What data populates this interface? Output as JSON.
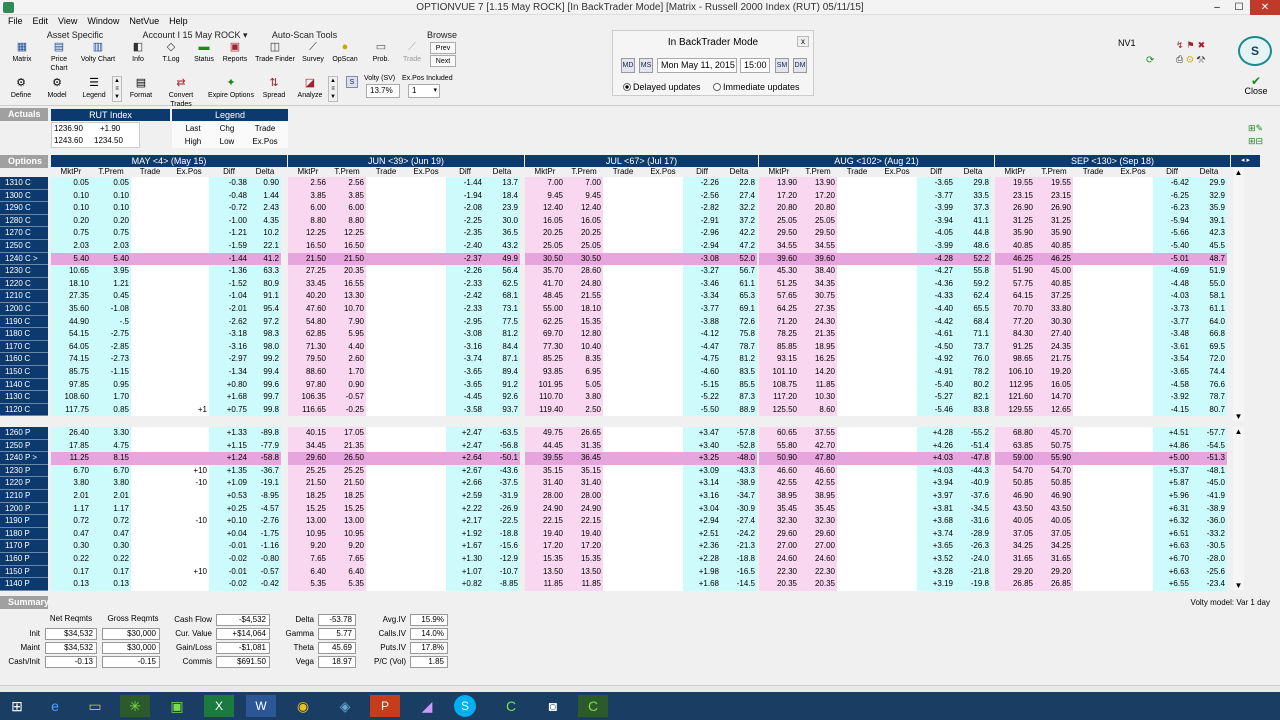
{
  "window": {
    "title": "OPTIONVUE 7    [1.15 May ROCK]    [In BackTrader Mode]    [Matrix - Russell 2000 Index (RUT)  05/11/15]",
    "min": "–",
    "max": "☐",
    "close": "✕"
  },
  "menu": [
    "File",
    "Edit",
    "View",
    "Window",
    "NetVue",
    "Help"
  ],
  "ribbon": {
    "groups": {
      "asset": "Asset Specific",
      "account": "Account I 15 May ROCK ▾",
      "autoscan": "Auto-Scan Tools",
      "browse": "Browse"
    },
    "row1": [
      "Matrix",
      "Price Chart",
      "Volty Chart",
      "Info",
      "T.Log",
      "Status",
      "Reports",
      "Trade Finder",
      "Survey",
      "OpScan",
      "Prob.",
      "Trade"
    ],
    "browse_prev": "Prev",
    "browse_next": "Next",
    "row2": [
      "Define",
      "Model",
      "Legend",
      "Format",
      "Convert Trades",
      "Expire Options",
      "Spread",
      "Analyze"
    ],
    "volty_label": "Volty (SV)",
    "volty_value": "13.7%",
    "expos_label": "Ex.Pos Included",
    "expos_value": "1",
    "s_btn": "S"
  },
  "backtrader": {
    "title": "In BackTrader Mode",
    "date": "Mon May 11, 2015",
    "time": "15:00",
    "delayed": "Delayed updates",
    "immediate": "Immediate updates",
    "btn_md": "MD",
    "btn_ms": "MS",
    "btn_sm": "SM",
    "btn_dm": "DM",
    "close": "x"
  },
  "right_top": {
    "nv": "NV1",
    "close_label": "Close",
    "s_icon": "S"
  },
  "actuals": {
    "label": "Actuals",
    "index_label": "RUT Index",
    "r1a": "1236.90",
    "r1b": "+1.90",
    "r2a": "1243.60",
    "r2b": "1234.50",
    "legend": "Legend",
    "leg": [
      "Last",
      "Chg",
      "Trade",
      "High",
      "Low",
      "Ex.Pos"
    ]
  },
  "options_label": "Options",
  "months": [
    "MAY <4> (May 15)",
    "JUN <39> (Jun 19)",
    "JUL <67> (Jul 17)",
    "AUG <102> (Aug 21)",
    "SEP <130> (Sep 18)"
  ],
  "may_cols": [
    "MktPr",
    "T.Prem",
    "Trade",
    "Ex.Pos",
    "Diff",
    "Delta"
  ],
  "other_cols": [
    "MktPr",
    "T.Prem",
    "Trade",
    "Ex.Pos",
    "Diff",
    "Delta"
  ],
  "calls": [
    [
      "1310 C",
      "0.05",
      "0.05",
      "",
      "",
      "-0.38",
      "0.90",
      "2.56",
      "2.56",
      "-1.44",
      "13.7",
      "7.00",
      "7.00",
      "-2.26",
      "22.8",
      "13.90",
      "13.90",
      "-3.65",
      "29.8",
      "19.55",
      "19.55",
      "-6.42",
      "29.9"
    ],
    [
      "1300 C",
      "0.10",
      "0.10",
      "",
      "",
      "-0.48",
      "1.44",
      "3.85",
      "3.85",
      "-1.94",
      "18.4",
      "9.45",
      "9.45",
      "-2.56",
      "27.4",
      "17.20",
      "17.20",
      "-3.77",
      "33.5",
      "23.15",
      "23.15",
      "-6.25",
      "32.9"
    ],
    [
      "1290 C",
      "0.10",
      "0.10",
      "",
      "",
      "-0.72",
      "2.43",
      "6.00",
      "6.00",
      "-2.08",
      "23.9",
      "12.40",
      "12.40",
      "-2.82",
      "32.2",
      "20.80",
      "20.80",
      "-3.99",
      "37.3",
      "26.90",
      "26.90",
      "-6.23",
      "35.9"
    ],
    [
      "1280 C",
      "0.20",
      "0.20",
      "",
      "",
      "-1.00",
      "4.35",
      "8.80",
      "8.80",
      "-2.25",
      "30.0",
      "16.05",
      "16.05",
      "-2.91",
      "37.2",
      "25.05",
      "25.05",
      "-3.94",
      "41.1",
      "31.25",
      "31.25",
      "-5.94",
      "39.1"
    ],
    [
      "1270 C",
      "0.75",
      "0.75",
      "",
      "",
      "-1.21",
      "10.2",
      "12.25",
      "12.25",
      "-2.35",
      "36.5",
      "20.25",
      "20.25",
      "-2.96",
      "42.2",
      "29.50",
      "29.50",
      "-4.05",
      "44.8",
      "35.90",
      "35.90",
      "-5.66",
      "42.3"
    ],
    [
      "1250 C",
      "2.03",
      "2.03",
      "",
      "",
      "-1.59",
      "22.1",
      "16.50",
      "16.50",
      "-2.40",
      "43.2",
      "25.05",
      "25.05",
      "-2.94",
      "47.2",
      "34.55",
      "34.55",
      "-3.99",
      "48.6",
      "40.85",
      "40.85",
      "-5.40",
      "45.5"
    ],
    [
      "1240 C >",
      "5.40",
      "5.40",
      "",
      "",
      "-1.44",
      "41.2",
      "21.50",
      "21.50",
      "-2.37",
      "49.9",
      "30.50",
      "30.50",
      "-3.08",
      "52.0",
      "39.60",
      "39.60",
      "-4.28",
      "52.2",
      "46.25",
      "46.25",
      "-5.01",
      "48.7"
    ],
    [
      "1230 C",
      "10.65",
      "3.95",
      "",
      "",
      "-1.36",
      "63.3",
      "27.25",
      "20.35",
      "-2.26",
      "56.4",
      "35.70",
      "28.60",
      "-3.27",
      "56.7",
      "45.30",
      "38.40",
      "-4.27",
      "55.8",
      "51.90",
      "45.00",
      "-4.69",
      "51.9"
    ],
    [
      "1220 C",
      "18.10",
      "1.21",
      "",
      "",
      "-1.52",
      "80.9",
      "33.45",
      "16.55",
      "-2.33",
      "62.5",
      "41.70",
      "24.80",
      "-3.46",
      "61.1",
      "51.25",
      "34.35",
      "-4.36",
      "59.2",
      "57.75",
      "40.85",
      "-4.48",
      "55.0"
    ],
    [
      "1210 C",
      "27.35",
      "0.45",
      "",
      "",
      "-1.04",
      "91.1",
      "40.20",
      "13.30",
      "-2.42",
      "68.1",
      "48.45",
      "21.55",
      "-3.34",
      "65.3",
      "57.65",
      "30.75",
      "-4.33",
      "62.4",
      "64.15",
      "37.25",
      "-4.03",
      "58.1"
    ],
    [
      "1200 C",
      "35.60",
      "-1.08",
      "",
      "",
      "-2.01",
      "95.4",
      "47.60",
      "10.70",
      "-2.33",
      "73.1",
      "55.00",
      "18.10",
      "-3.77",
      "69.1",
      "64.25",
      "27.35",
      "-4.40",
      "65.5",
      "70.70",
      "33.80",
      "-3.73",
      "61.1"
    ],
    [
      "1190 C",
      "44.90",
      "-.5",
      "",
      "",
      "-2.62",
      "97.2",
      "54.80",
      "7.90",
      "-2.95",
      "77.5",
      "62.25",
      "15.35",
      "-3.88",
      "72.6",
      "71.20",
      "24.30",
      "-4.42",
      "68.4",
      "77.20",
      "30.30",
      "-3.77",
      "64.0"
    ],
    [
      "1180 C",
      "54.15",
      "-2.75",
      "",
      "",
      "-3.18",
      "98.3",
      "62.85",
      "5.95",
      "-3.08",
      "81.2",
      "69.70",
      "12.80",
      "-4.12",
      "75.8",
      "78.25",
      "21.35",
      "-4.61",
      "71.1",
      "84.30",
      "27.40",
      "-3.48",
      "66.8"
    ],
    [
      "1170 C",
      "64.05",
      "-2.85",
      "",
      "",
      "-3.16",
      "98.0",
      "71.30",
      "4.40",
      "-3.16",
      "84.4",
      "77.30",
      "10.40",
      "-4.47",
      "78.7",
      "85.85",
      "18.95",
      "-4.50",
      "73.7",
      "91.25",
      "24.35",
      "-3.61",
      "69.5"
    ],
    [
      "1160 C",
      "74.15",
      "-2.73",
      "",
      "",
      "-2.97",
      "99.2",
      "79.50",
      "2.60",
      "-3.74",
      "87.1",
      "85.25",
      "8.35",
      "-4.75",
      "81.2",
      "93.15",
      "16.25",
      "-4.92",
      "76.0",
      "98.65",
      "21.75",
      "-3.54",
      "72.0"
    ],
    [
      "1150 C",
      "85.75",
      "-1.15",
      "",
      "",
      "-1.34",
      "99.4",
      "88.60",
      "1.70",
      "-3.65",
      "89.4",
      "93.85",
      "6.95",
      "-4.60",
      "83.5",
      "101.10",
      "14.20",
      "-4.91",
      "78.2",
      "106.10",
      "19.20",
      "-3.65",
      "74.4"
    ],
    [
      "1140 C",
      "97.85",
      "0.95",
      "",
      "",
      "+0.80",
      "99.6",
      "97.80",
      "0.90",
      "-3.65",
      "91.2",
      "101.95",
      "5.05",
      "-5.15",
      "85.5",
      "108.75",
      "11.85",
      "-5.40",
      "80.2",
      "112.95",
      "16.05",
      "-4.58",
      "76.6"
    ],
    [
      "1130 C",
      "108.60",
      "1.70",
      "",
      "",
      "+1.68",
      "99.7",
      "106.35",
      "-0.57",
      "-4.45",
      "92.6",
      "110.70",
      "3.80",
      "-5.22",
      "87.3",
      "117.20",
      "10.30",
      "-5.27",
      "82.1",
      "121.60",
      "14.70",
      "-3.92",
      "78.7"
    ],
    [
      "1120 C",
      "117.75",
      "0.85",
      "",
      "+1",
      "+0.75",
      "99.8",
      "116.65",
      "-0.25",
      "-3.58",
      "93.7",
      "119.40",
      "2.50",
      "-5.50",
      "88.9",
      "125.50",
      "8.60",
      "-5.46",
      "83.8",
      "129.55",
      "12.65",
      "-4.15",
      "80.7"
    ]
  ],
  "puts": [
    [
      "1260 P",
      "26.40",
      "3.30",
      "",
      "",
      "+1.33",
      "-89.8",
      "40.15",
      "17.05",
      "+2.47",
      "-63.5",
      "49.75",
      "26.65",
      "+3.47",
      "-57.8",
      "60.65",
      "37.55",
      "+4.28",
      "-55.2",
      "68.80",
      "45.70",
      "+4.51",
      "-57.7"
    ],
    [
      "1250 P",
      "17.85",
      "4.75",
      "",
      "",
      "+1.15",
      "-77.9",
      "34.45",
      "21.35",
      "+2.47",
      "-56.8",
      "44.45",
      "31.35",
      "+3.40",
      "-52.8",
      "55.80",
      "42.70",
      "+4.26",
      "-51.4",
      "63.85",
      "50.75",
      "+4.86",
      "-54.5"
    ],
    [
      "1240 P >",
      "11.25",
      "8.15",
      "",
      "",
      "+1.24",
      "-58.8",
      "29.60",
      "26.50",
      "+2.64",
      "-50.1",
      "39.55",
      "36.45",
      "+3.25",
      "-48.0",
      "50.90",
      "47.80",
      "+4.03",
      "-47.8",
      "59.00",
      "55.90",
      "+5.00",
      "-51.3"
    ],
    [
      "1230 P",
      "6.70",
      "6.70",
      "",
      "+10",
      "+1.35",
      "-36.7",
      "25.25",
      "25.25",
      "+2.67",
      "-43.6",
      "35.15",
      "35.15",
      "+3.09",
      "-43.3",
      "46.60",
      "46.60",
      "+4.03",
      "-44.3",
      "54.70",
      "54.70",
      "+5.37",
      "-48.1"
    ],
    [
      "1220 P",
      "3.80",
      "3.80",
      "",
      "-10",
      "+1.09",
      "-19.1",
      "21.50",
      "21.50",
      "+2.66",
      "-37.5",
      "31.40",
      "31.40",
      "+3.14",
      "-38.9",
      "42.55",
      "42.55",
      "+3.94",
      "-40.9",
      "50.85",
      "50.85",
      "+5.87",
      "-45.0"
    ],
    [
      "1210 P",
      "2.01",
      "2.01",
      "",
      "",
      "+0.53",
      "-8.95",
      "18.25",
      "18.25",
      "+2.59",
      "-31.9",
      "28.00",
      "28.00",
      "+3.16",
      "-34.7",
      "38.95",
      "38.95",
      "+3.97",
      "-37.6",
      "46.90",
      "46.90",
      "+5.96",
      "-41.9"
    ],
    [
      "1200 P",
      "1.17",
      "1.17",
      "",
      "",
      "+0.25",
      "-4.57",
      "15.25",
      "15.25",
      "+2.22",
      "-26.9",
      "24.90",
      "24.90",
      "+3.04",
      "-30.9",
      "35.45",
      "35.45",
      "+3.81",
      "-34.5",
      "43.50",
      "43.50",
      "+6.31",
      "-38.9"
    ],
    [
      "1190 P",
      "0.72",
      "0.72",
      "",
      "-10",
      "+0.10",
      "-2.76",
      "13.00",
      "13.00",
      "+2.17",
      "-22.5",
      "22.15",
      "22.15",
      "+2.94",
      "-27.4",
      "32.30",
      "32.30",
      "+3.68",
      "-31.6",
      "40.05",
      "40.05",
      "+6.32",
      "-36.0"
    ],
    [
      "1180 P",
      "0.47",
      "0.47",
      "",
      "",
      "+0.04",
      "-1.75",
      "10.95",
      "10.95",
      "+1.92",
      "-18.8",
      "19.40",
      "19.40",
      "+2.51",
      "-24.2",
      "29.60",
      "29.60",
      "+3.74",
      "-28.9",
      "37.05",
      "37.05",
      "+6.51",
      "-33.2"
    ],
    [
      "1170 P",
      "0.30",
      "0.30",
      "",
      "",
      "-0.01",
      "-1.16",
      "9.20",
      "9.20",
      "+1.67",
      "-15.6",
      "17.20",
      "17.20",
      "+2.36",
      "-21.3",
      "27.00",
      "27.00",
      "+3.65",
      "-26.3",
      "34.25",
      "34.25",
      "+6.63",
      "-30.5"
    ],
    [
      "1160 P",
      "0.22",
      "0.22",
      "",
      "",
      "-0.02",
      "-0.80",
      "7.65",
      "7.65",
      "+1.30",
      "-12.9",
      "15.35",
      "15.35",
      "+2.28",
      "-18.8",
      "24.60",
      "24.60",
      "+3.52",
      "-24.0",
      "31.65",
      "31.65",
      "+6.70",
      "-28.0"
    ],
    [
      "1150 P",
      "0.17",
      "0.17",
      "",
      "+10",
      "-0.01",
      "-0.57",
      "6.40",
      "6.40",
      "+1.07",
      "-10.7",
      "13.50",
      "13.50",
      "+1.98",
      "-16.5",
      "22.30",
      "22.30",
      "+3.28",
      "-21.8",
      "29.20",
      "29.20",
      "+6.63",
      "-25.6"
    ],
    [
      "1140 P",
      "0.13",
      "0.13",
      "",
      "",
      "-0.02",
      "-0.42",
      "5.35",
      "5.35",
      "+0.82",
      "-8.85",
      "11.85",
      "11.85",
      "+1.68",
      "-14.5",
      "20.35",
      "20.35",
      "+3.19",
      "-19.8",
      "26.85",
      "26.85",
      "+6.55",
      "-23.4"
    ]
  ],
  "summary": {
    "label": "Summary",
    "model": "Volty model: Var 1 day",
    "net_h": "Net Reqmts",
    "gross_h": "Gross Reqmts",
    "rows": [
      {
        "l": "Init",
        "n": "$34,532",
        "g": "$30,000"
      },
      {
        "l": "Maint",
        "n": "$34,532",
        "g": "$30,000"
      },
      {
        "l": "Cash/Init",
        "n": "-0.13",
        "g": "-0.15"
      }
    ],
    "cash": [
      {
        "l": "Cash Flow",
        "v": "-$4,532"
      },
      {
        "l": "Cur. Value",
        "v": "+$14,064"
      },
      {
        "l": "Gain/Loss",
        "v": "-$1,081"
      },
      {
        "l": "Commis",
        "v": "$691.50"
      }
    ],
    "greeks": [
      {
        "l": "Delta",
        "v": "-53.78"
      },
      {
        "l": "Gamma",
        "v": "5.77"
      },
      {
        "l": "Theta",
        "v": "45.69"
      },
      {
        "l": "Vega",
        "v": "18.97"
      }
    ],
    "iv": [
      {
        "l": "Avg.IV",
        "v": "15.9%"
      },
      {
        "l": "Calls.IV",
        "v": "14.0%"
      },
      {
        "l": "Puts.IV",
        "v": "17.8%"
      },
      {
        "l": "P/C (Vol)",
        "v": "1.85"
      }
    ]
  },
  "colors": {
    "header": "#0d3a6e",
    "pink": "#f9d7f0",
    "cyan": "#cdfafa",
    "atm": "#e7a5de",
    "white": "#ffffff"
  }
}
